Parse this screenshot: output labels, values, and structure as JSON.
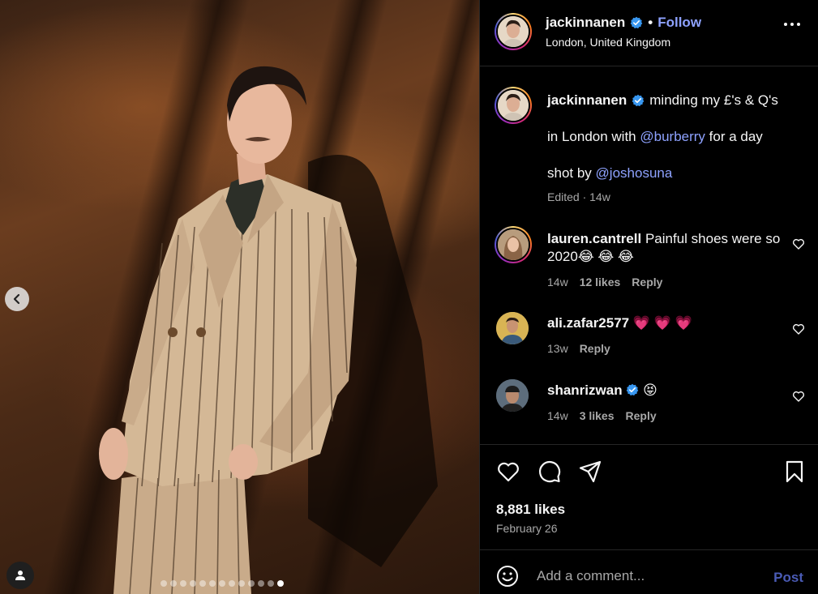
{
  "post": {
    "author": "jackinnanen",
    "location": "London, United Kingdom",
    "follow_label": "Follow",
    "bullet": "•"
  },
  "caption": {
    "username": "jackinnanen",
    "line1": "minding my £'s & Q's",
    "line2_pre": "in London with ",
    "line2_mention": "@burberry",
    "line2_post": " for a day",
    "line3_pre": "shot by ",
    "line3_mention": "@joshosuna",
    "edited": "Edited · 14w"
  },
  "comments": [
    {
      "username": "lauren.cantrell",
      "text_line1": "Painful shoes were so",
      "text_line2": "2020😂 😂 😂",
      "time": "14w",
      "likes": "12 likes",
      "reply": "Reply"
    },
    {
      "username": "ali.zafar2577",
      "text": "💗 💗 💗",
      "time": "13w",
      "reply": "Reply"
    },
    {
      "username": "shanrizwan",
      "text": "😝",
      "time": "14w",
      "likes": "3 likes",
      "reply": "Reply"
    }
  ],
  "stats": {
    "likes": "8,881 likes",
    "date": "February 26"
  },
  "composer": {
    "placeholder": "Add a comment...",
    "post_label": "Post"
  },
  "carousel": {
    "total_slides": 13,
    "active_index": 12
  },
  "icons": {
    "verified": "verified-badge-icon",
    "more": "more-options-icon",
    "prev": "chevron-left-icon",
    "user_tag": "user-tag-icon",
    "like": "heart-icon",
    "comment": "comment-icon",
    "share": "share-icon",
    "save": "bookmark-icon",
    "emoji": "emoji-icon"
  },
  "colors": {
    "link": "#8ea2ff",
    "verified": "#3897f0",
    "post_button_disabled": "#4a5bb5",
    "secondary_text": "#a8a8a8"
  }
}
